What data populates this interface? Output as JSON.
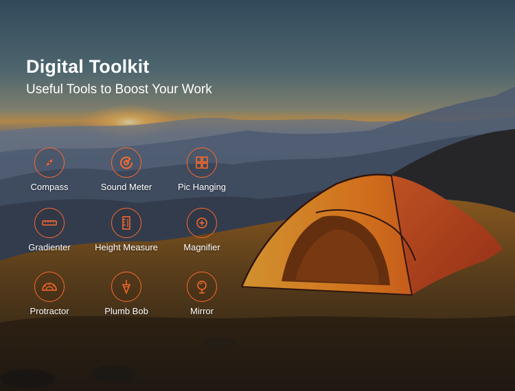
{
  "hero": {
    "title": "Digital Toolkit",
    "subtitle": "Useful Tools to Boost Your Work"
  },
  "accent_color": "#ff6a2b",
  "tools": [
    {
      "label": "Compass",
      "icon": "compass-icon"
    },
    {
      "label": "Sound Meter",
      "icon": "sound-meter-icon"
    },
    {
      "label": "Pic Hanging",
      "icon": "pic-hanging-icon"
    },
    {
      "label": "Gradienter",
      "icon": "gradienter-icon"
    },
    {
      "label": "Height Measure",
      "icon": "height-measure-icon"
    },
    {
      "label": "Magnifier",
      "icon": "magnifier-icon"
    },
    {
      "label": "Protractor",
      "icon": "protractor-icon"
    },
    {
      "label": "Plumb Bob",
      "icon": "plumb-bob-icon"
    },
    {
      "label": "Mirror",
      "icon": "mirror-icon"
    }
  ]
}
